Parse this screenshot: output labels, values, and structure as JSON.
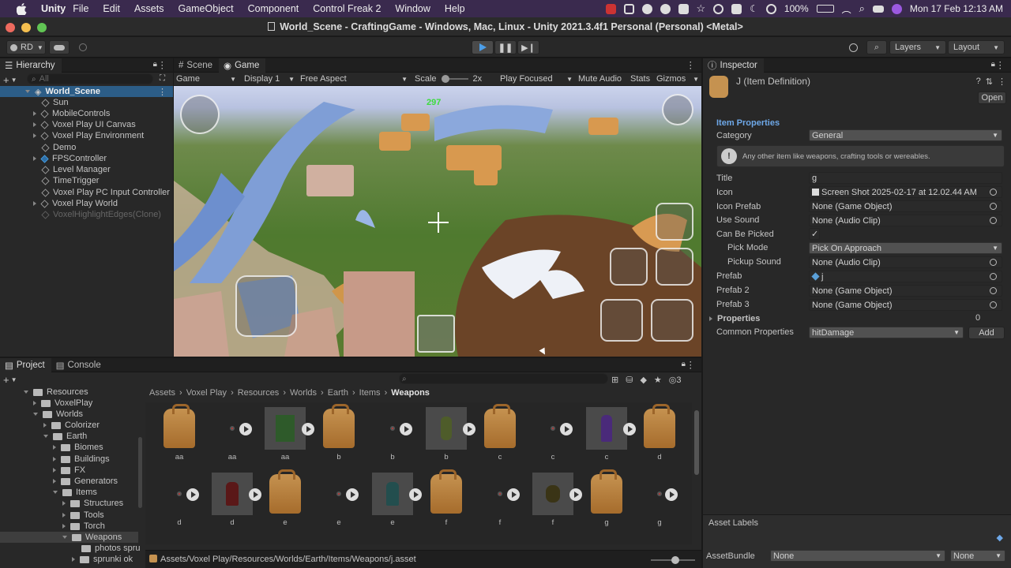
{
  "menubar": {
    "app": "Unity",
    "items": [
      "File",
      "Edit",
      "Assets",
      "GameObject",
      "Component",
      "Control Freak 2",
      "Window",
      "Help"
    ],
    "battery": "100%",
    "datetime": "Mon 17 Feb  12:13 AM"
  },
  "window": {
    "title": "World_Scene - CraftingGame - Windows, Mac, Linux - Unity 2021.3.4f1 Personal (Personal) <Metal>"
  },
  "toolbar": {
    "account": "RD",
    "layers": "Layers",
    "layout": "Layout"
  },
  "hierarchy": {
    "tab": "Hierarchy",
    "search_placeholder": "All",
    "scene": "World_Scene",
    "items": [
      "Sun",
      "MobileControls",
      "Voxel Play UI Canvas",
      "Voxel Play Environment",
      "Demo",
      "FPSController",
      "Level Manager",
      "TimeTrigger",
      "Voxel Play PC Input Controller",
      "Voxel Play World",
      "VoxelHighlightEdges(Clone)"
    ]
  },
  "game": {
    "tabs": [
      "Scene",
      "Game"
    ],
    "mode": "Game",
    "display": "Display 1",
    "aspect": "Free Aspect",
    "scale_label": "Scale",
    "scale_value": "2x",
    "play_focused": "Play Focused",
    "mute": "Mute Audio",
    "stats": "Stats",
    "gizmos": "Gizmos",
    "counter": "297"
  },
  "project": {
    "tabs": [
      "Project",
      "Console"
    ],
    "tree": [
      "Resources",
      "VoxelPlay",
      "Worlds",
      "Colorizer",
      "Earth",
      "Biomes",
      "Buildings",
      "FX",
      "Generators",
      "Items",
      "Structures",
      "Tools",
      "Torch",
      "Weapons",
      "photos spru",
      "sprunki ok"
    ],
    "breadcrumb": [
      "Assets",
      "Voxel Play",
      "Resources",
      "Worlds",
      "Earth",
      "Items",
      "Weapons"
    ],
    "hidden_count": "3",
    "row1_labels": [
      "aa",
      "aa",
      "aa",
      "b",
      "b",
      "b",
      "c",
      "c",
      "c",
      "d"
    ],
    "row2_labels": [
      "d",
      "d",
      "e",
      "e",
      "e",
      "f",
      "f",
      "f",
      "g",
      "g"
    ],
    "status_path": "Assets/Voxel Play/Resources/Worlds/Earth/Items/Weapons/j.asset"
  },
  "inspector": {
    "tab": "Inspector",
    "object": "J (Item Definition)",
    "open_label": "Open",
    "section": "Item Properties",
    "category_label": "Category",
    "category_value": "General",
    "help_text": "Any other item like weapons, crafting tools or wereables.",
    "fields": [
      {
        "label": "Title",
        "value": "g"
      },
      {
        "label": "Icon",
        "value": "Screen Shot 2025-02-17 at 12.02.44 AM"
      },
      {
        "label": "Icon Prefab",
        "value": "None (Game Object)"
      },
      {
        "label": "Use Sound",
        "value": "None (Audio Clip)"
      },
      {
        "label": "Can Be Picked",
        "value": "✓"
      },
      {
        "label": "Pick Mode",
        "value": "Pick On Approach"
      },
      {
        "label": "Pickup Sound",
        "value": "None (Audio Clip)"
      },
      {
        "label": "Prefab",
        "value": "j"
      },
      {
        "label": "Prefab 2",
        "value": "None (Game Object)"
      },
      {
        "label": "Prefab 3",
        "value": "None (Game Object)"
      }
    ],
    "properties_label": "Properties",
    "properties_count": "0",
    "common_label": "Common Properties",
    "common_value": "hitDamage",
    "add_label": "Add",
    "asset_labels": "Asset Labels",
    "assetbundle_label": "AssetBundle",
    "assetbundle_value": "None",
    "assetbundle_variant": "None"
  },
  "colors": {
    "accent": "#3d87d8",
    "menubar": "#3a2a4e",
    "panel": "#282828"
  }
}
